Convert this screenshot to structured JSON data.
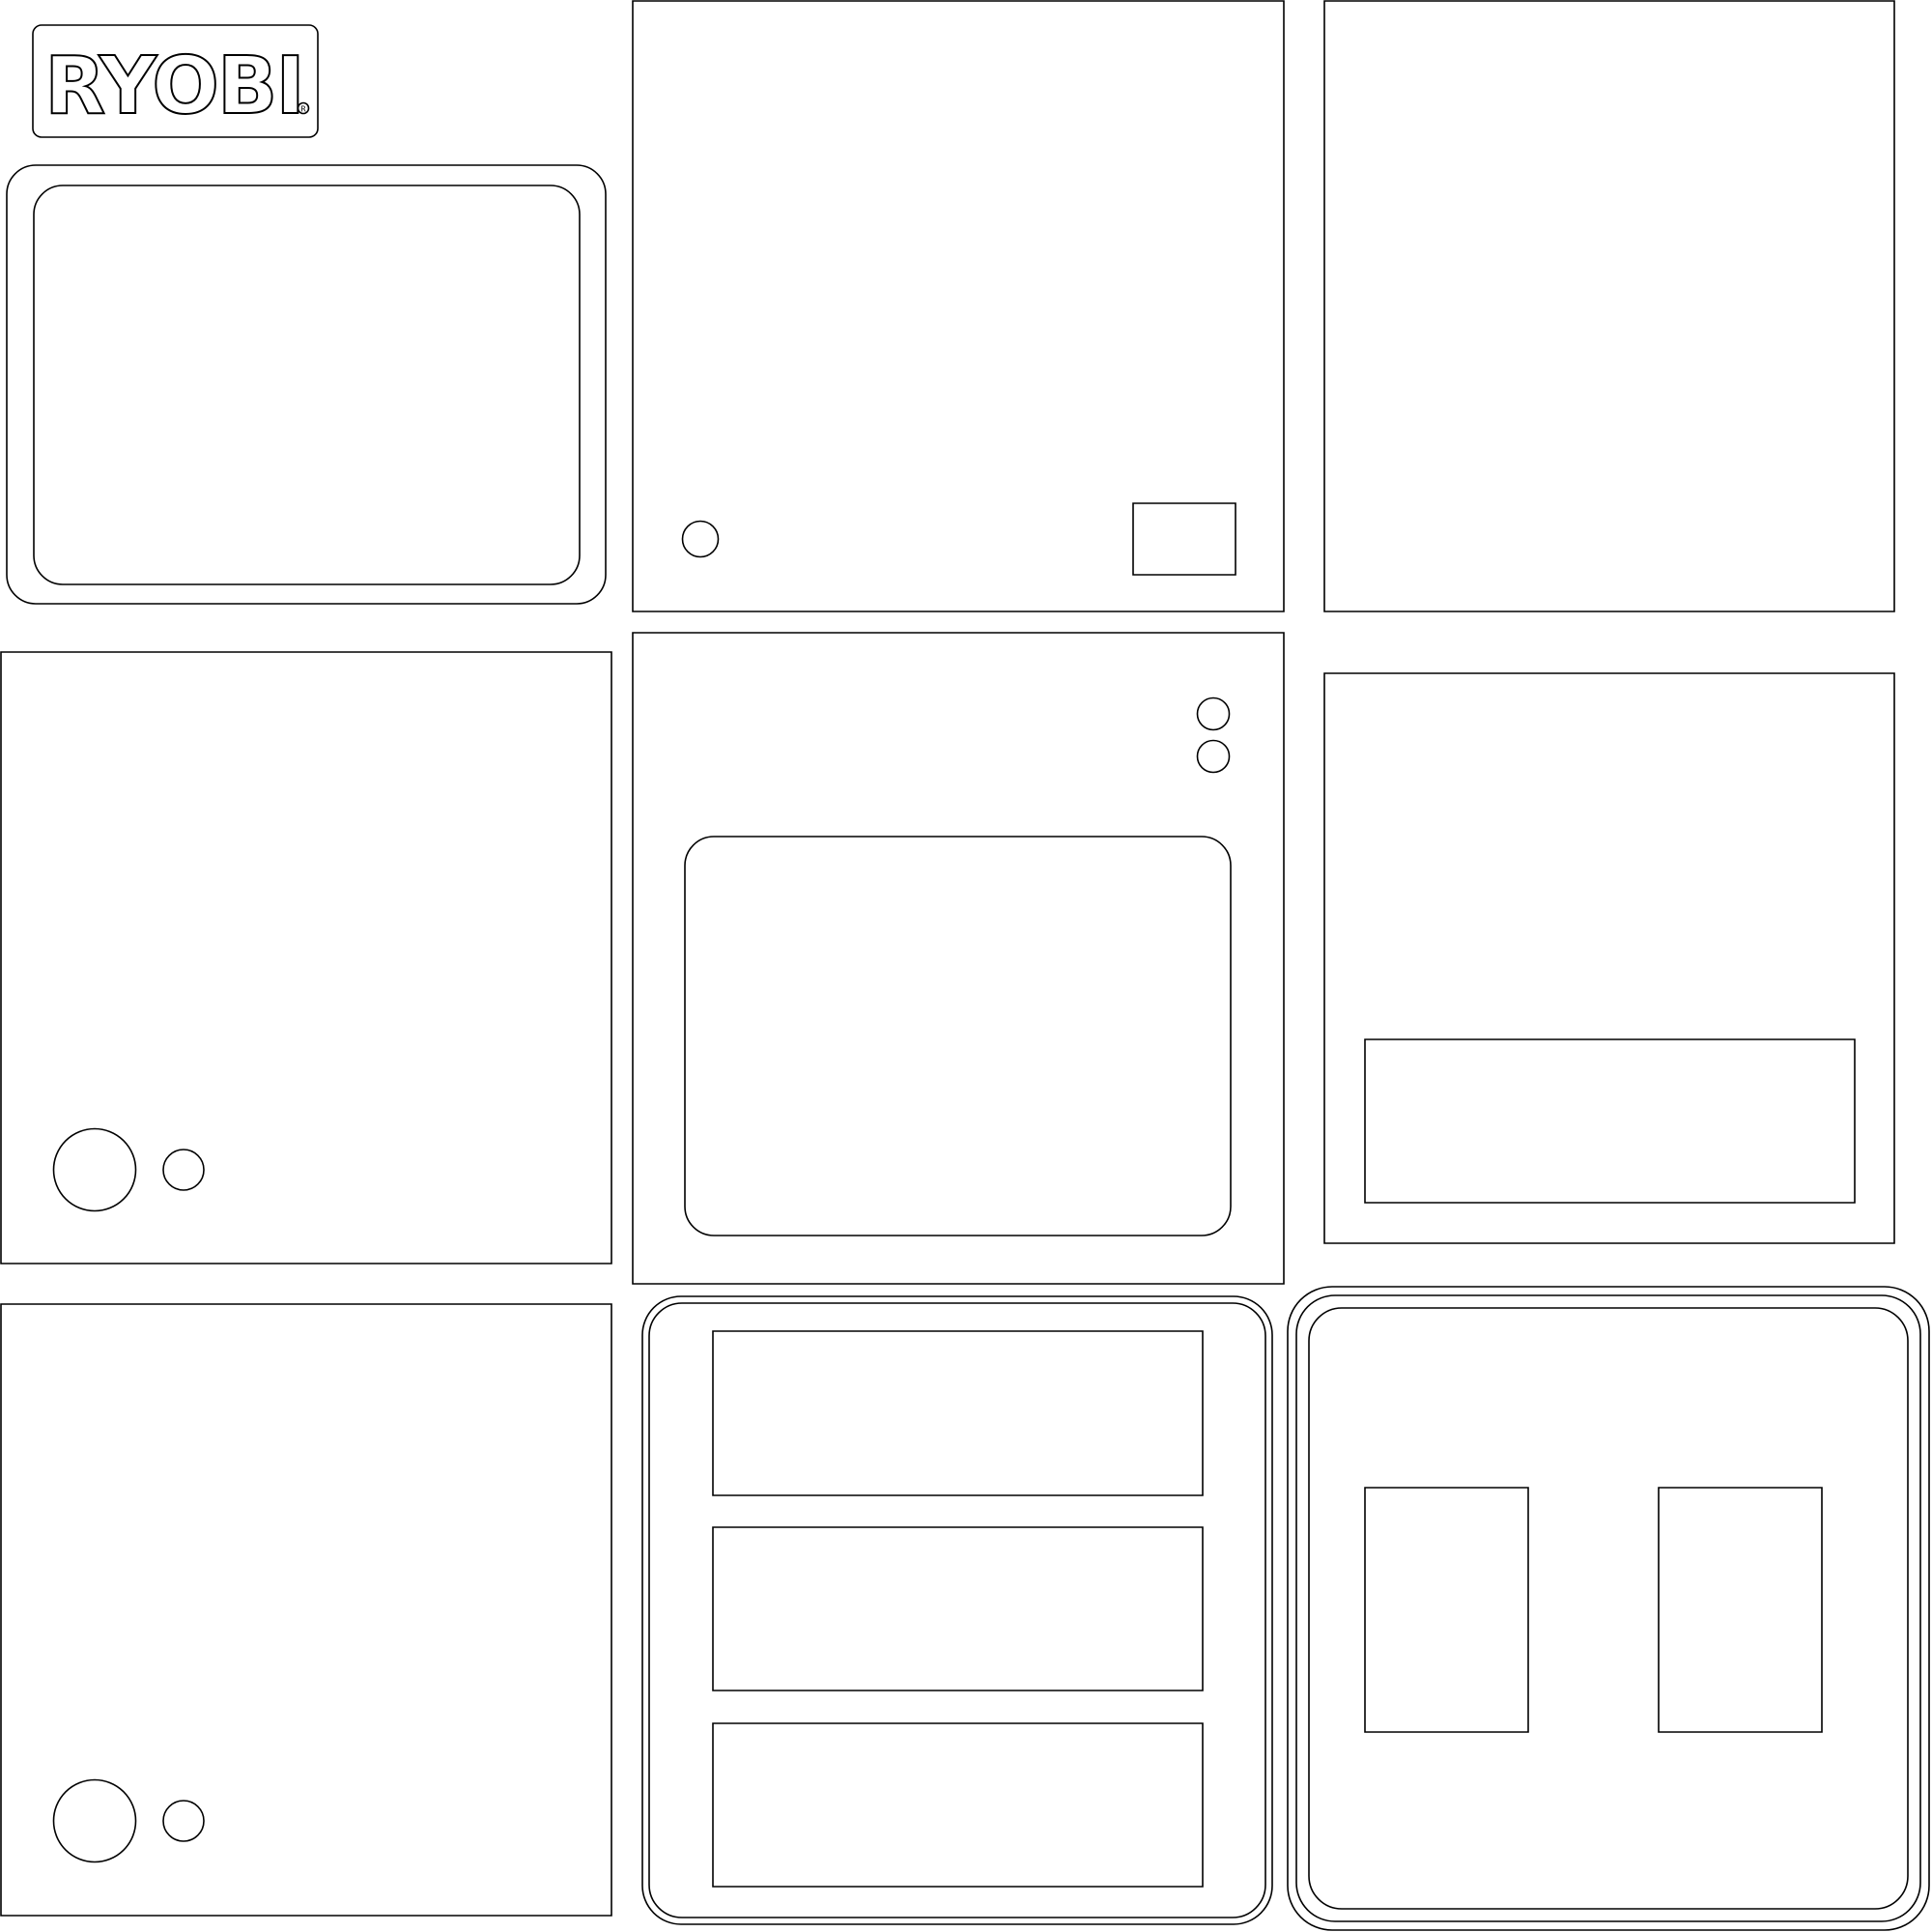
{
  "logo": {
    "text": "RYOBI",
    "registered_mark": "R"
  },
  "style": {
    "stroke_color": "#000000",
    "background_color": "#ffffff"
  },
  "panels": [
    {
      "id": "panel-1",
      "shape": "rounded-frame-with-inner-window"
    },
    {
      "id": "panel-2",
      "shape": "square-with-small-circle-and-small-rectangle"
    },
    {
      "id": "panel-3",
      "shape": "empty-square"
    },
    {
      "id": "panel-4",
      "shape": "square-with-two-circles"
    },
    {
      "id": "panel-5",
      "shape": "square-with-two-small-circles-and-rounded-window"
    },
    {
      "id": "panel-6",
      "shape": "square-with-wide-rectangle"
    },
    {
      "id": "panel-7",
      "shape": "square-with-two-circles"
    },
    {
      "id": "panel-8",
      "shape": "rounded-frame-with-three-rectangles"
    },
    {
      "id": "panel-9",
      "shape": "rounded-frame-with-two-rectangles"
    }
  ]
}
